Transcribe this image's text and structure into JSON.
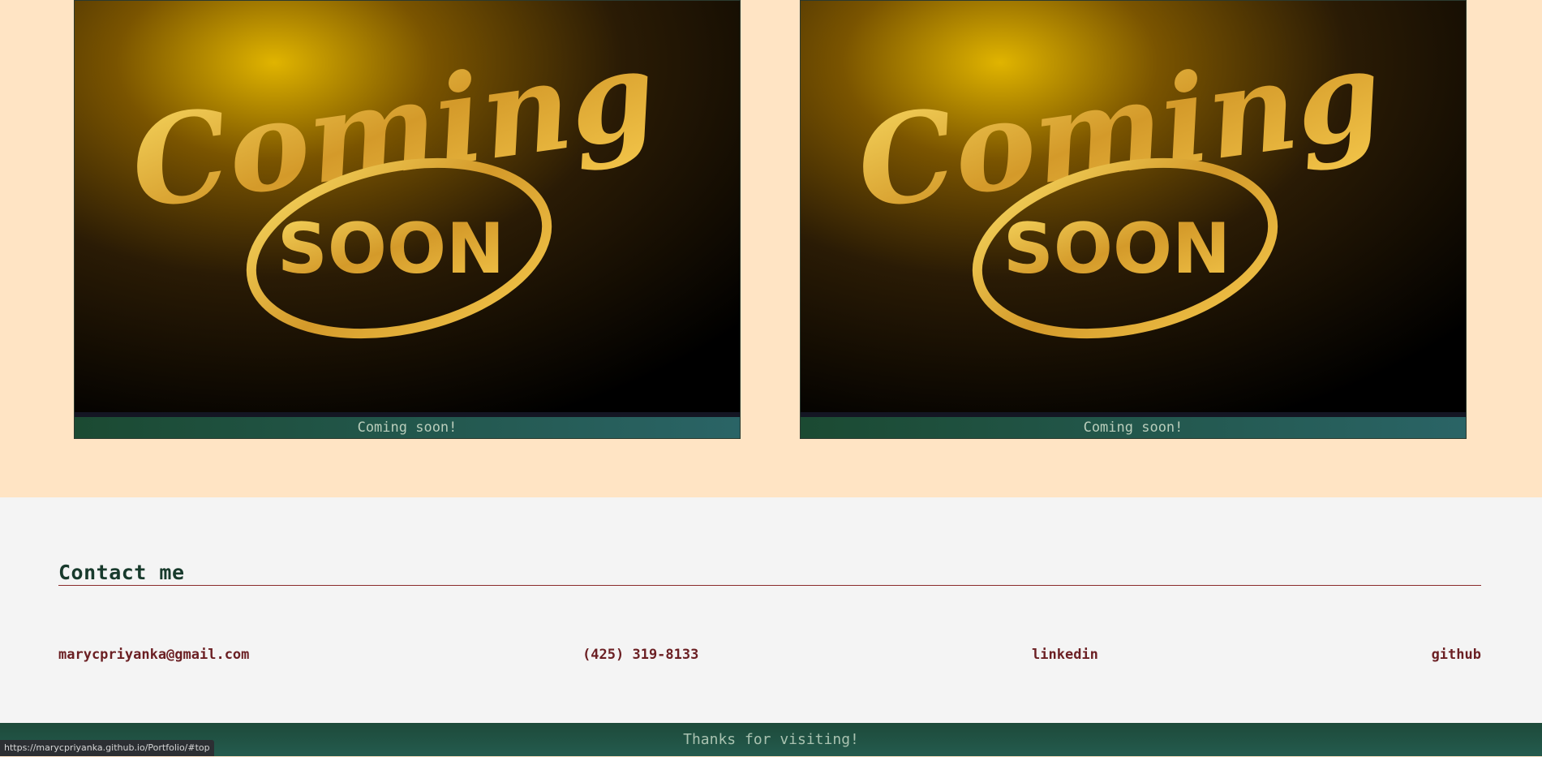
{
  "projects": {
    "cards": [
      {
        "image_alt": "Coming Soon",
        "image_script": "Coming",
        "image_badge": "SOON",
        "caption": "Coming soon!"
      },
      {
        "image_alt": "Coming Soon",
        "image_script": "Coming",
        "image_badge": "SOON",
        "caption": "Coming soon!"
      }
    ]
  },
  "contact": {
    "heading": "Contact me",
    "email": "marycpriyanka@gmail.com",
    "phone": "(425) 319-8133",
    "linkedin": "linkedin",
    "github": "github"
  },
  "footer": {
    "text": "Thanks for visiting!"
  },
  "status_bar": {
    "url": "https://marycpriyanka.github.io/Portfolio/#top"
  },
  "colors": {
    "page_bg": "#ffe4c4",
    "contact_bg": "#f4f4f4",
    "heading": "#183a2c",
    "link": "#6b1f23",
    "footer": "#245b4e",
    "gold": "#e8b632"
  }
}
